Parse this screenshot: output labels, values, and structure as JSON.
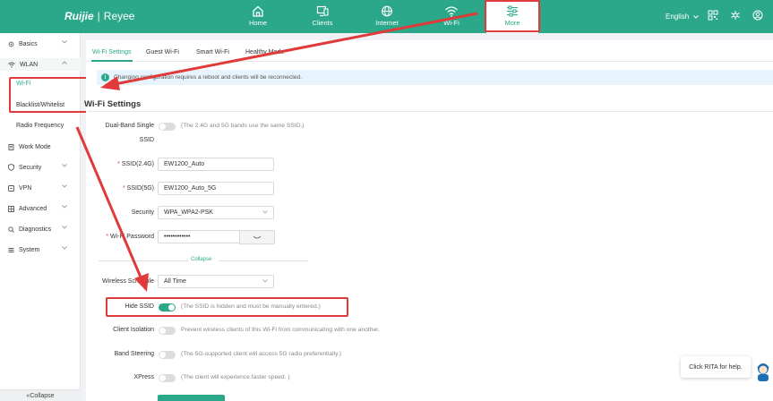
{
  "brand": {
    "name": "Ruijie",
    "separator": "|",
    "product": "Reyee"
  },
  "nav": [
    {
      "id": "home",
      "label": "Home",
      "icon": "home-icon"
    },
    {
      "id": "clients",
      "label": "Clients",
      "icon": "monitor-icon"
    },
    {
      "id": "internet",
      "label": "Internet",
      "icon": "globe-icon"
    },
    {
      "id": "wifi",
      "label": "Wi-Fi",
      "icon": "wifi-icon"
    },
    {
      "id": "more",
      "label": "More",
      "icon": "sliders-icon"
    }
  ],
  "header": {
    "language": "English"
  },
  "sidebar": {
    "items": [
      {
        "label": "Basics",
        "icon": "gear-icon"
      },
      {
        "label": "WLAN",
        "icon": "wifi-icon"
      },
      {
        "label": "Work Mode",
        "icon": "document-icon"
      },
      {
        "label": "Security",
        "icon": "shield-icon"
      },
      {
        "label": "VPN",
        "icon": "vpn-icon"
      },
      {
        "label": "Advanced",
        "icon": "advanced-icon"
      },
      {
        "label": "Diagnostics",
        "icon": "diagnostics-icon"
      },
      {
        "label": "System",
        "icon": "system-icon"
      }
    ],
    "wlan_sub": [
      "Wi-Fi",
      "Blacklist/Whitelist",
      "Radio Frequency"
    ],
    "collapse": "Collapse"
  },
  "tabs": [
    "Wi-Fi Settings",
    "Guest Wi-Fi",
    "Smart Wi-Fi",
    "Healthy Mode"
  ],
  "notice": "Changing configuration requires a reboot and clients will be reconnected.",
  "section_title": "Wi-Fi Settings",
  "form": {
    "dual_band_label_1": "Dual-Band Single",
    "dual_band_label_2": "SSID",
    "dual_band_hint": "(The 2.4G and 5G bands use the same SSID.)",
    "ssid24_label": "SSID(2.4G)",
    "ssid24_value": "EW1200_Auto",
    "ssid5_label": "SSID(5G)",
    "ssid5_value": "EW1200_Auto_5G",
    "security_label": "Security",
    "security_value": "WPA_WPA2-PSK",
    "password_label": "Wi-Fi Password",
    "password_value": "••••••••••••",
    "collapse_label": "Collapse",
    "schedule_label": "Wireless Schedule",
    "schedule_value": "All Time",
    "hide_ssid_label": "Hide SSID",
    "hide_ssid_hint": "(The SSID is hidden and must be manually entered.)",
    "hide_ssid_on": true,
    "client_isolation_label": "Client Isolation",
    "client_isolation_hint": "Prevent wireless clients of this Wi-Fi from communicating with one another.",
    "band_steering_label": "Band Steering",
    "band_steering_hint": "(The 5G-supported client will access 5G radio preferentially.)",
    "xpress_label": "XPress",
    "xpress_hint": "(The client will experience faster speed. )"
  },
  "help": {
    "text": "Click RITA for help."
  },
  "colors": {
    "accent": "#2ba889",
    "highlight": "#e03a3a"
  }
}
